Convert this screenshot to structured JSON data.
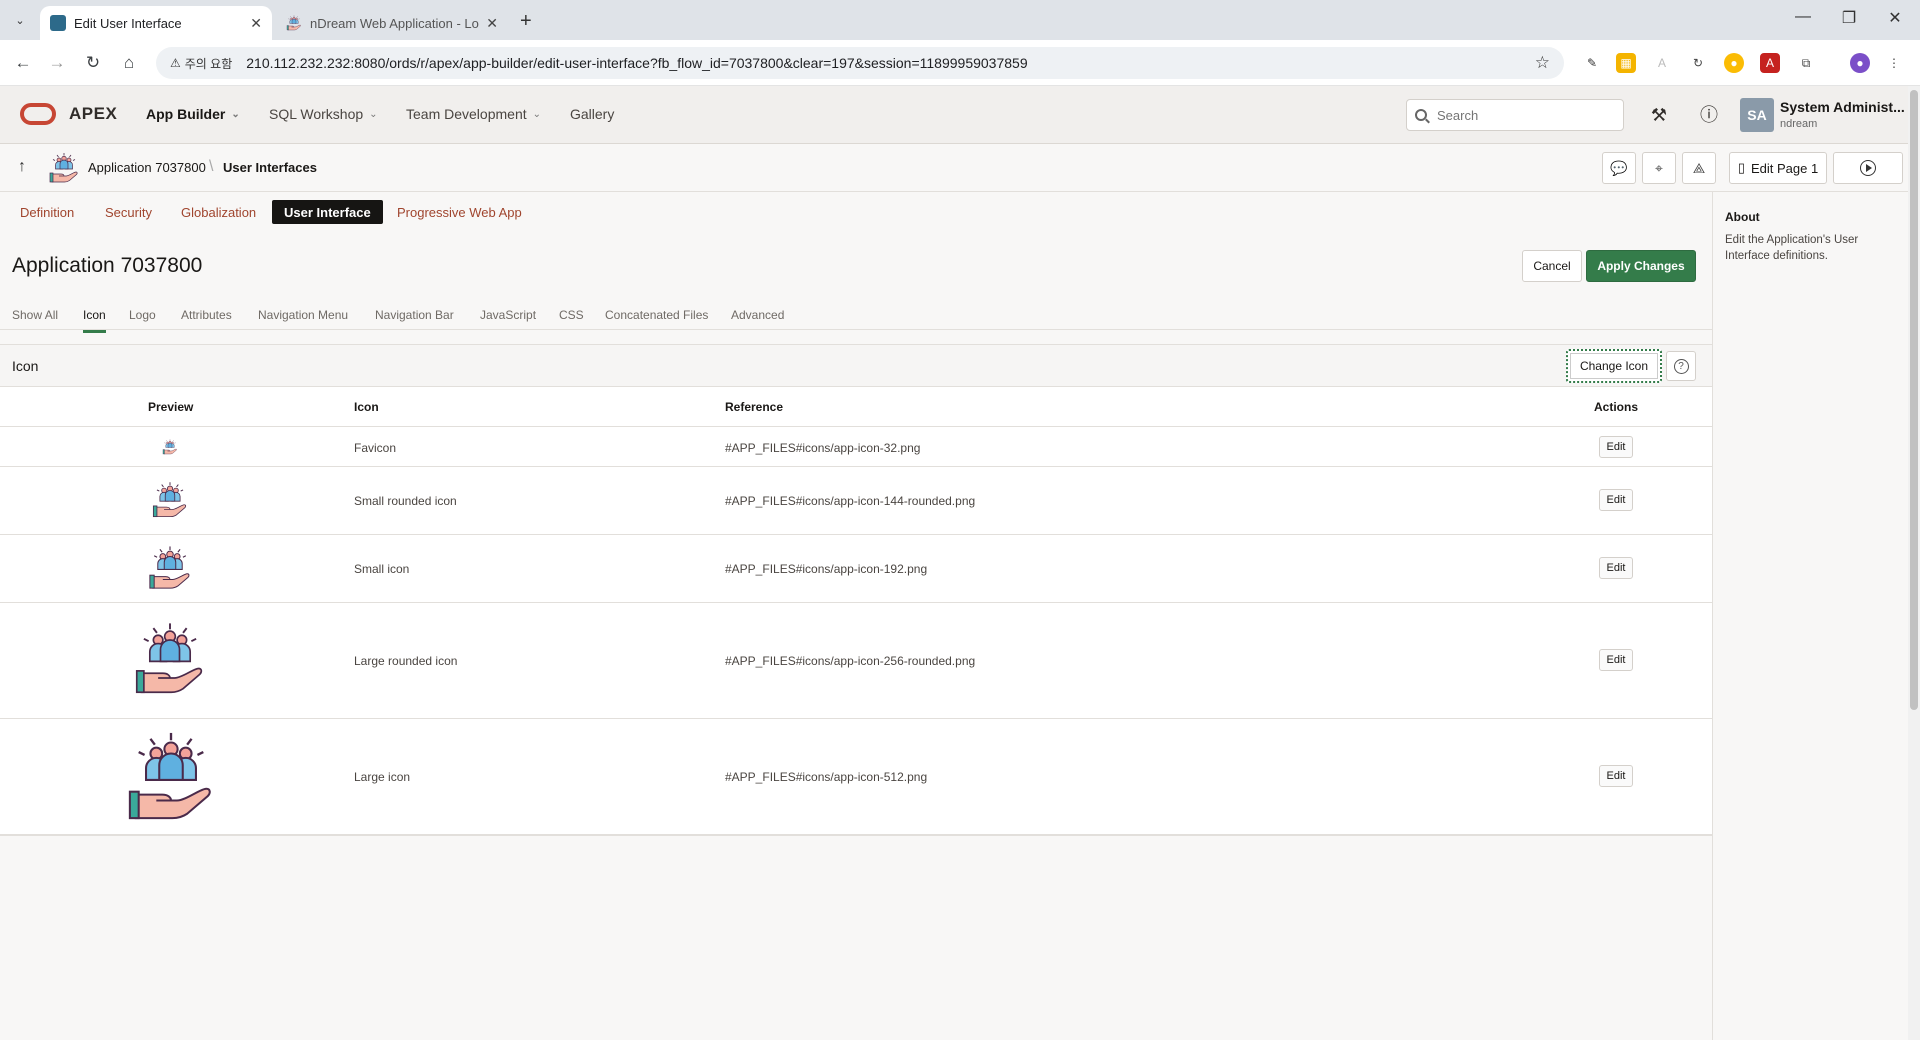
{
  "browser": {
    "tabs": [
      {
        "title": "Edit User Interface",
        "active": true
      },
      {
        "title": "nDream Web Application - Lo",
        "active": false
      }
    ],
    "security_warning": "주의 요함",
    "url": "210.112.232.232:8080/ords/r/apex/app-builder/edit-user-interface?fb_flow_id=7037800&clear=197&session=11899959037859"
  },
  "header": {
    "brand": "APEX",
    "nav": [
      {
        "label": "App Builder",
        "active": true
      },
      {
        "label": "SQL Workshop",
        "active": false
      },
      {
        "label": "Team Development",
        "active": false
      },
      {
        "label": "Gallery",
        "active": false
      }
    ],
    "search_placeholder": "Search",
    "user_initials": "SA",
    "user_name": "System Administ...",
    "user_workspace": "ndream"
  },
  "breadcrumb": {
    "app": "Application 7037800",
    "current": "User Interfaces",
    "edit_page_label": "Edit Page 1"
  },
  "section_tabs": [
    {
      "label": "Definition",
      "active": false
    },
    {
      "label": "Security",
      "active": false
    },
    {
      "label": "Globalization",
      "active": false
    },
    {
      "label": "User Interface",
      "active": true
    },
    {
      "label": "Progressive Web App",
      "active": false
    }
  ],
  "page": {
    "title": "Application 7037800",
    "cancel_label": "Cancel",
    "apply_label": "Apply Changes"
  },
  "sub_tabs": [
    {
      "label": "Show All",
      "active": false
    },
    {
      "label": "Icon",
      "active": true
    },
    {
      "label": "Logo",
      "active": false
    },
    {
      "label": "Attributes",
      "active": false
    },
    {
      "label": "Navigation Menu",
      "active": false
    },
    {
      "label": "Navigation Bar",
      "active": false
    },
    {
      "label": "JavaScript",
      "active": false
    },
    {
      "label": "CSS",
      "active": false
    },
    {
      "label": "Concatenated Files",
      "active": false
    },
    {
      "label": "Advanced",
      "active": false
    }
  ],
  "icon_region": {
    "title": "Icon",
    "change_icon_label": "Change Icon",
    "columns": [
      "Preview",
      "Icon",
      "Reference",
      "Actions"
    ],
    "rows": [
      {
        "icon": "Favicon",
        "reference": "#APP_FILES#icons/app-icon-32.png",
        "action": "Edit"
      },
      {
        "icon": "Small rounded icon",
        "reference": "#APP_FILES#icons/app-icon-144-rounded.png",
        "action": "Edit"
      },
      {
        "icon": "Small icon",
        "reference": "#APP_FILES#icons/app-icon-192.png",
        "action": "Edit"
      },
      {
        "icon": "Large rounded icon",
        "reference": "#APP_FILES#icons/app-icon-256-rounded.png",
        "action": "Edit"
      },
      {
        "icon": "Large icon",
        "reference": "#APP_FILES#icons/app-icon-512.png",
        "action": "Edit"
      }
    ]
  },
  "about": {
    "title": "About",
    "text": "Edit the Application's User Interface definitions."
  },
  "colors": {
    "accent_green": "#347c4a",
    "link_red": "#a0452e",
    "oracle_red": "#c74634"
  }
}
